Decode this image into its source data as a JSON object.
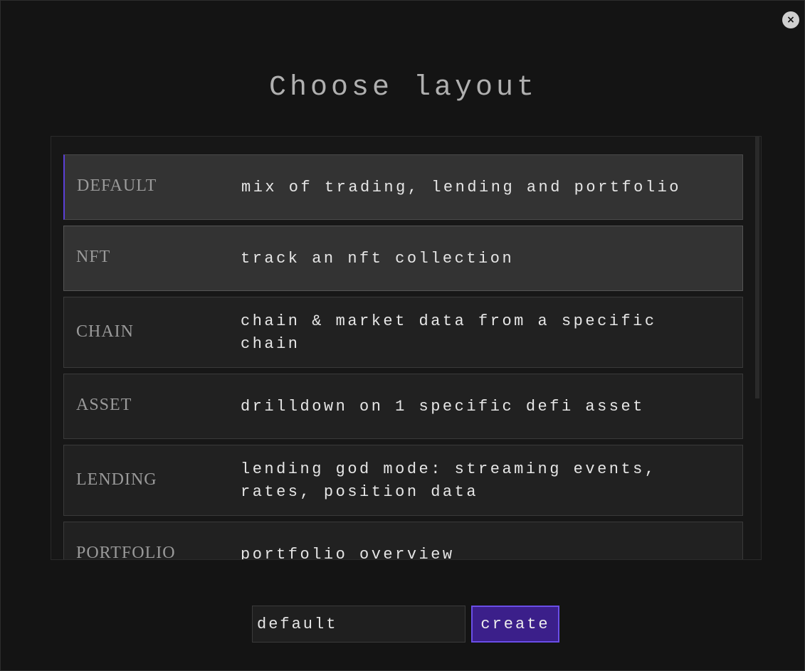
{
  "dialog": {
    "title": "Choose layout",
    "close_label": "×"
  },
  "layouts": [
    {
      "name": "DEFAULT",
      "description": "mix of trading, lending and portfolio"
    },
    {
      "name": "NFT",
      "description": "track an nft collection"
    },
    {
      "name": "CHAIN",
      "description": "chain & market data from a specific chain"
    },
    {
      "name": "ASSET",
      "description": "drilldown on 1 specific defi asset"
    },
    {
      "name": "LENDING",
      "description": "lending god mode: streaming events, rates, position data"
    },
    {
      "name": "PORTFOLIO",
      "description": "portfolio overview"
    }
  ],
  "footer": {
    "layout_name_value": "default",
    "create_label": "create"
  },
  "colors": {
    "background": "#141414",
    "accent": "#5b3fd6",
    "create_button_bg": "#3b1f8a"
  }
}
